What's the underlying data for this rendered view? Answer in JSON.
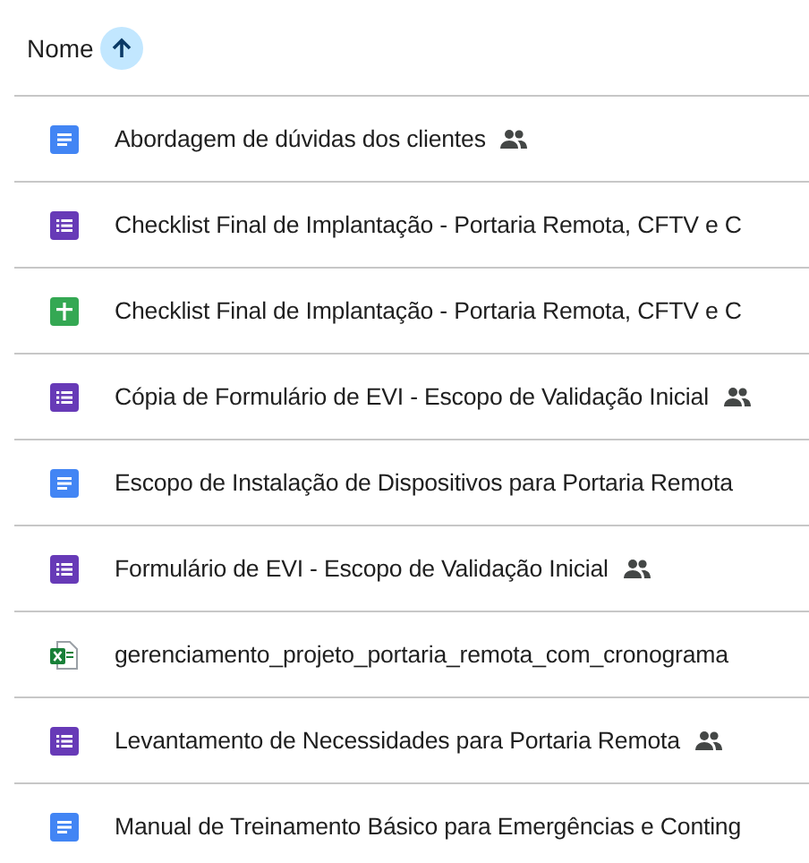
{
  "header": {
    "label": "Nome",
    "ascending": true
  },
  "files": [
    {
      "name": "Abordagem de dúvidas dos clientes",
      "kind": "doc",
      "shared": true
    },
    {
      "name": "Checklist Final de Implantação - Portaria Remota, CFTV e C",
      "kind": "form",
      "shared": false
    },
    {
      "name": "Checklist Final de Implantação - Portaria Remota, CFTV e C",
      "kind": "sheet",
      "shared": false
    },
    {
      "name": "Cópia de Formulário de EVI - Escopo de Validação Inicial",
      "kind": "form",
      "shared": true
    },
    {
      "name": "Escopo de Instalação de Dispositivos para Portaria Remota",
      "kind": "doc",
      "shared": false
    },
    {
      "name": "Formulário de EVI - Escopo de Validação Inicial",
      "kind": "form",
      "shared": true
    },
    {
      "name": "gerenciamento_projeto_portaria_remota_com_cronograma",
      "kind": "excel",
      "shared": false
    },
    {
      "name": "Levantamento de Necessidades para Portaria Remota",
      "kind": "form",
      "shared": true
    },
    {
      "name": "Manual de Treinamento Básico para Emergências e Conting",
      "kind": "doc",
      "shared": false
    }
  ]
}
